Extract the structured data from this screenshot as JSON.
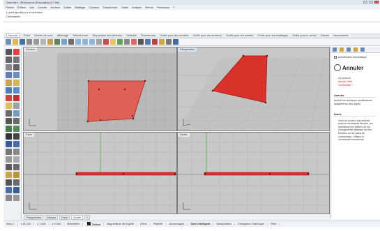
{
  "window": {
    "title": "Sans titre - Rhinoceros (Education) (17 bit)"
  },
  "menubar": [
    "Fichier",
    "Édition",
    "Vue",
    "Courbe",
    "Surface",
    "Solide",
    "Maillage",
    "Cotation",
    "Transformer",
    "Outils",
    "Analyse",
    "Rendu",
    "Panneaux",
    "?"
  ],
  "command_history": [
    "1 point ajouté(s) à la sélection",
    "Commande :"
  ],
  "tabs": [
    "Normal",
    "Point",
    "Dessin de cour",
    "Affichage",
    "Sélectionner",
    "Disposition des fenêtres",
    "Visibilité",
    "Transformer",
    "Outils pour les courbes",
    "Outils pour les surfaces",
    "Outils pour les solides",
    "Outils pour les maillages",
    "Outils pour le rendu",
    "Dessin",
    "Nouveautés"
  ],
  "viewports": {
    "top": "Dessus",
    "perspective": "Perspective",
    "front": "Face",
    "right": "Droite"
  },
  "right_panel": {
    "auto_update": "Actualisation automatique",
    "command_name": "Annuler",
    "where_link_prefix": "Où peut-on",
    "where_link": "trouver cette",
    "where_link_suffix": "commande ?",
    "section_title": "Annuler",
    "description": "Annule les dernières modifications réalisées sur des objets.",
    "notes_title": "Notes",
    "notes_text": "Vous ne pouvez pas annuler, avec la commande Annuler, les opérations sur fichiers ou les changements affectant sur les fenêtres ou les plans de construction. Utilisez la commande Annulervue"
  },
  "viewport_tabs": [
    "Perspective",
    "Dessus",
    "Face",
    "Droite",
    "+"
  ],
  "status": {
    "cplane": "Plan-C",
    "x": "x 81.240",
    "y": "y 7.555",
    "z": "z 0.000",
    "units": "Millimètres",
    "layer": "Défaut",
    "toggles": [
      "Magnétisme de la grille",
      "Ortho",
      "Planéité",
      "Accrochages",
      "Suivi intelligent",
      "Manipulateur",
      "Enregistrer l'historique",
      "Filtre"
    ],
    "active_toggle": "Suivi intelligent"
  },
  "colors": {
    "accent": "#d8302a",
    "viewport_bg": "#c8c8c8",
    "grid_line": "#b3b3b3"
  }
}
